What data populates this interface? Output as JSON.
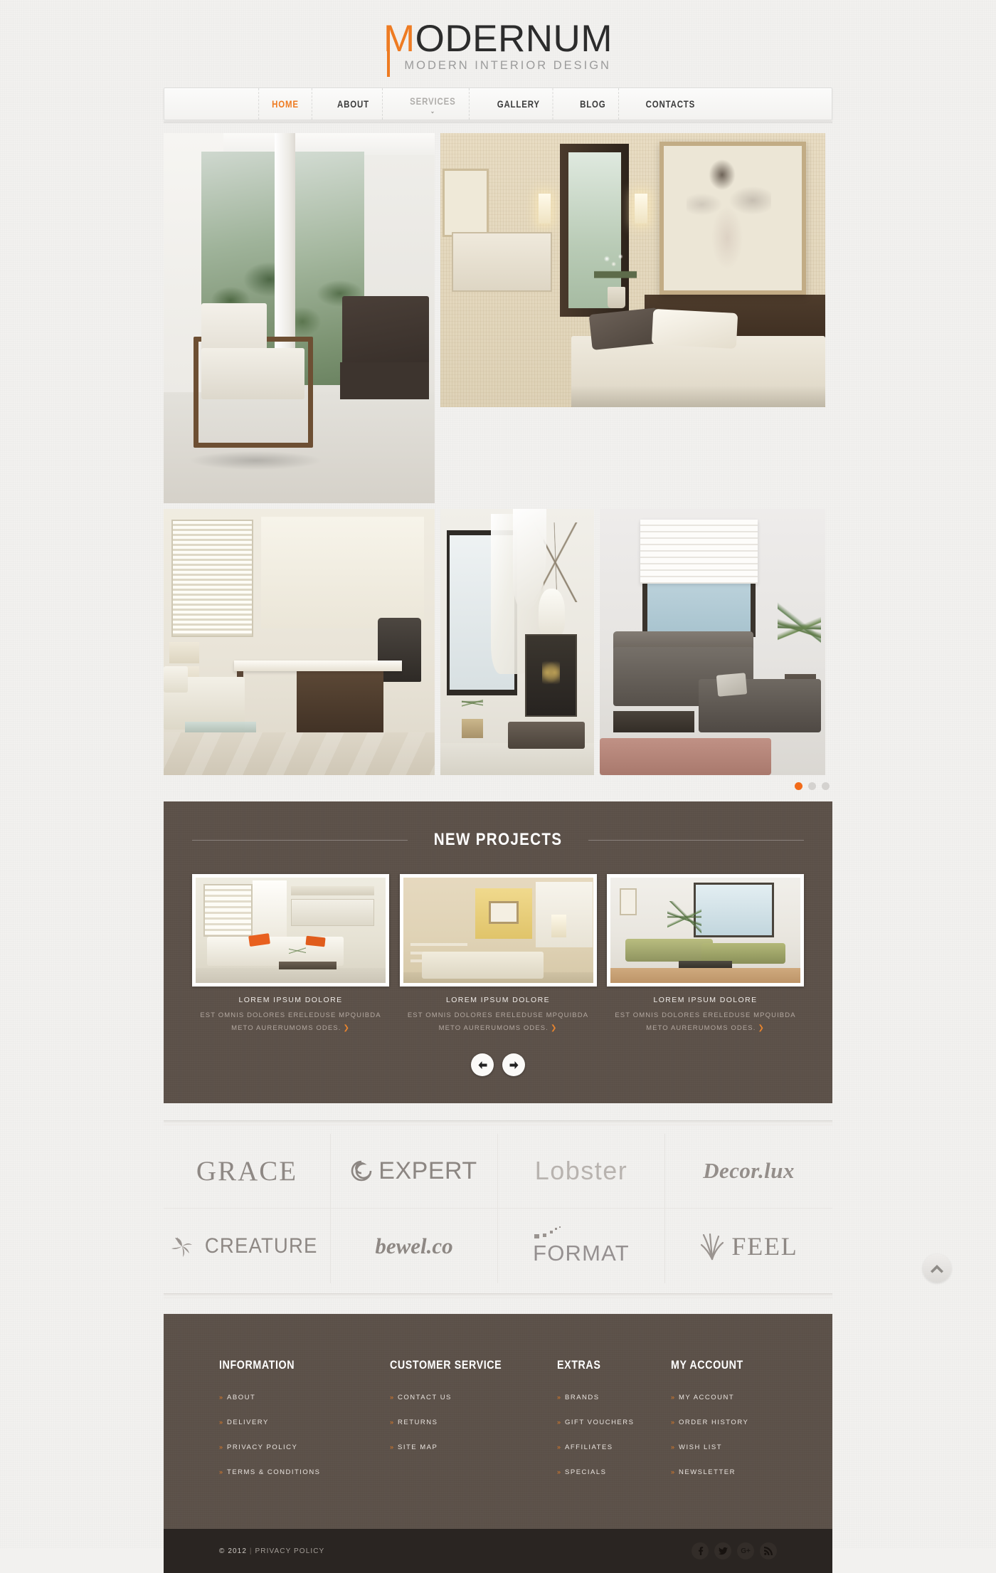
{
  "brand": {
    "name_prefix": "M",
    "name_rest": "ODERNUM",
    "tagline": "MODERN INTERIOR DESIGN",
    "accent_color": "#ee7b22"
  },
  "nav": {
    "items": [
      {
        "label": "HOME",
        "state": "active"
      },
      {
        "label": "ABOUT",
        "state": "default"
      },
      {
        "label": "SERVICES",
        "state": "muted",
        "has_dropdown": true,
        "chevron": "⌄"
      },
      {
        "label": "GALLERY",
        "state": "default"
      },
      {
        "label": "BLOG",
        "state": "default"
      },
      {
        "label": "CONTACTS",
        "state": "default"
      }
    ]
  },
  "gallery": {
    "dots": [
      {
        "active": true
      },
      {
        "active": false
      },
      {
        "active": false
      }
    ]
  },
  "projects": {
    "title": "NEW PROJECTS",
    "cards": [
      {
        "title": "LOREM IPSUM DOLORE",
        "line1": "EST OMNIS DOLORES ERELEDUSE MPQUIBDA",
        "line2": "METO AURERUMOMS ODES.",
        "more": "❯"
      },
      {
        "title": "LOREM IPSUM DOLORE",
        "line1": "EST OMNIS DOLORES ERELEDUSE MPQUIBDA",
        "line2": "METO AURERUMOMS ODES.",
        "more": "❯"
      },
      {
        "title": "LOREM IPSUM DOLORE",
        "line1": "EST OMNIS DOLORES ERELEDUSE MPQUIBDA",
        "line2": "METO AURERUMOMS ODES.",
        "more": "❯"
      }
    ],
    "prev_icon": "arrow-left-icon",
    "next_icon": "arrow-right-icon",
    "background_color": "#5c5149"
  },
  "partners": [
    {
      "name": "GRACE",
      "icon": null
    },
    {
      "name": "EXPERT",
      "icon": "swirl-circle-icon"
    },
    {
      "name": "Lobster",
      "icon": null
    },
    {
      "name": "Decor.lux",
      "icon": null
    },
    {
      "name": "CREATURE",
      "icon": "pinwheel-icon"
    },
    {
      "name": "bewel.co",
      "icon": null
    },
    {
      "name": "FORMAT",
      "icon": "pixel-dots-icon"
    },
    {
      "name": "FEEL",
      "icon": "grass-icon"
    }
  ],
  "footer": {
    "columns": [
      {
        "title": "INFORMATION",
        "links": [
          "ABOUT",
          "DELIVERY",
          "PRIVACY POLICY",
          "TERMS & CONDITIONS"
        ]
      },
      {
        "title": "CUSTOMER SERVICE",
        "links": [
          "CONTACT US",
          "RETURNS",
          "SITE MAP"
        ]
      },
      {
        "title": "EXTRAS",
        "links": [
          "BRANDS",
          "GIFT VOUCHERS",
          "AFFILIATES",
          "SPECIALS"
        ]
      },
      {
        "title": "MY ACCOUNT",
        "links": [
          "MY ACCOUNT",
          "ORDER HISTORY",
          "WISH LIST",
          "NEWSLETTER"
        ]
      }
    ],
    "bullet": "»",
    "bullet_color": "#e07c28",
    "background_color": "#5c5149"
  },
  "copyright": {
    "text": "© 2012",
    "separator": "|",
    "link": "PRIVACY POLICY",
    "socials": [
      {
        "name": "facebook-icon",
        "glyph": "f"
      },
      {
        "name": "twitter-icon",
        "glyph": "ᵗ"
      },
      {
        "name": "google-plus-icon",
        "glyph": "G+"
      },
      {
        "name": "rss-icon",
        "glyph": "◔"
      }
    ],
    "background_color": "#2a2522"
  },
  "back_to_top": {
    "icon": "chevron-up-icon"
  }
}
